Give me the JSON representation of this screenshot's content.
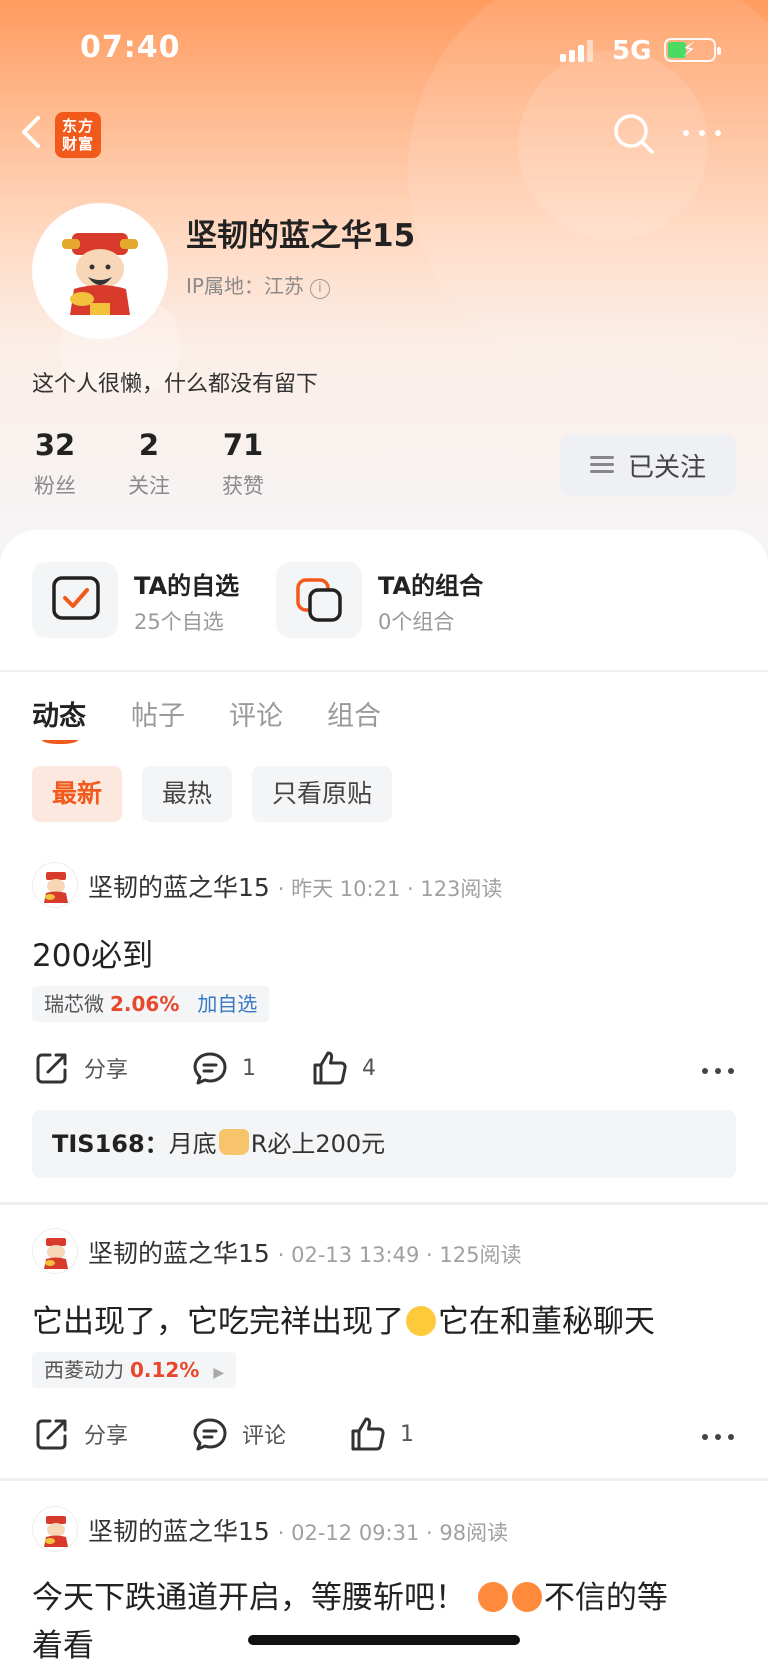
{
  "status_bar": {
    "time": "07:40",
    "network": "5G"
  },
  "nav": {
    "logo_line1": "东方",
    "logo_line2": "财富"
  },
  "profile": {
    "name": "坚韧的蓝之华15",
    "ip_location": "IP属地：江苏",
    "bio": "这个人很懒，什么都没有留下",
    "stats": [
      {
        "value": "32",
        "label": "粉丝"
      },
      {
        "value": "2",
        "label": "关注"
      },
      {
        "value": "71",
        "label": "获赞"
      }
    ],
    "follow_label": "已关注"
  },
  "entries": [
    {
      "title": "TA的自选",
      "subtitle": "25个自选"
    },
    {
      "title": "TA的组合",
      "subtitle": "0个组合"
    }
  ],
  "tabs": [
    "动态",
    "帖子",
    "评论",
    "组合"
  ],
  "filters": [
    "最新",
    "最热",
    "只看原贴"
  ],
  "posts": [
    {
      "author": "坚韧的蓝之华15",
      "meta": "· 昨天 10:21 · 123阅读",
      "body": "200必到",
      "stock_name": "瑞芯微",
      "stock_pct": "2.06%",
      "stock_action": "加自选",
      "share": "分享",
      "comments": "1",
      "likes": "4",
      "comment_author": "TIS168：",
      "comment_pre": "月底",
      "comment_post": "R必上200元"
    },
    {
      "author": "坚韧的蓝之华15",
      "meta": "· 02-13 13:49 · 125阅读",
      "body_pre": "它出现了，它吃完祥出现了",
      "body_post": "它在和董秘聊天",
      "stock_name": "西菱动力",
      "stock_pct": "0.12%",
      "share": "分享",
      "comments": "评论",
      "likes": "1"
    },
    {
      "author": "坚韧的蓝之华15",
      "meta": "· 02-12 09:31 · 98阅读",
      "body_line1_pre": "今天下跌通道开启，等腰斩吧！",
      "body_line1_post": "不信的等",
      "body_line2": "着看"
    }
  ],
  "colors": {
    "accent": "#f25a1c",
    "up_red": "#e8472b",
    "link_blue": "#3a78c6"
  }
}
